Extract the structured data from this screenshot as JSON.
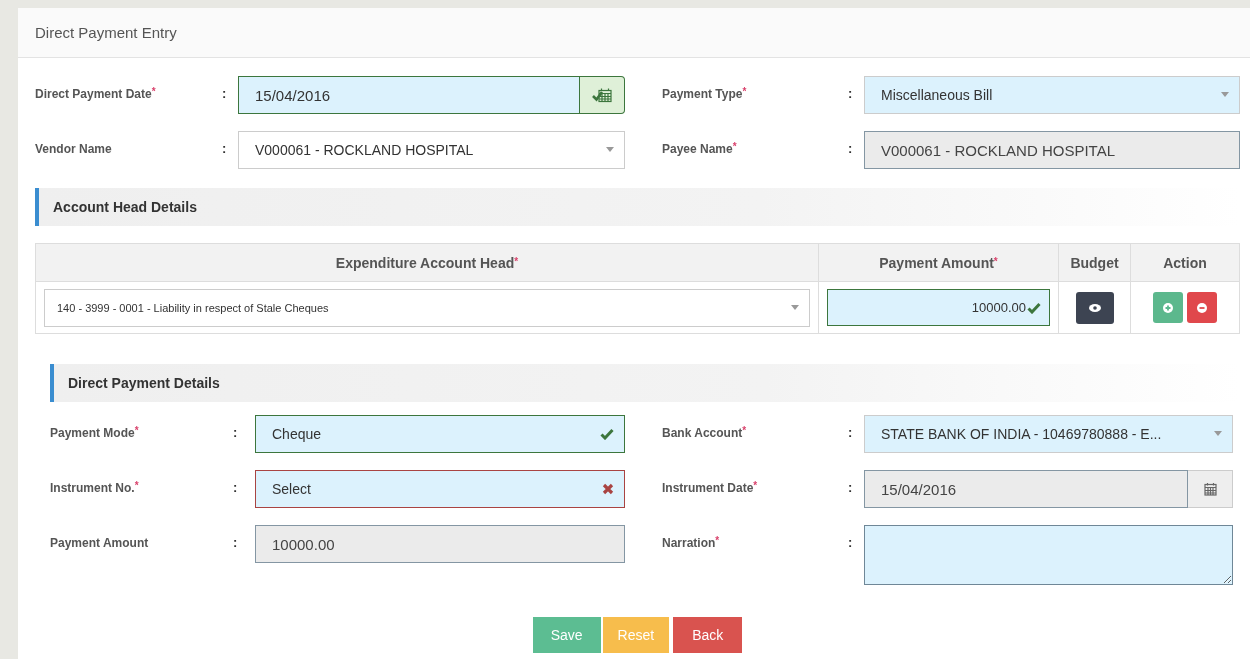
{
  "page_title": "Direct Payment Entry",
  "header_fields": [
    {
      "label": "Direct Payment Date$^{*}$",
      "colon": ":",
      "kind": "date",
      "value": "15/04/2016",
      "highlighted": true,
      "valid": true,
      "invalid": false,
      "readonly": false
    },
    {
      "label": "Payment Type$^{*}$",
      "colon": ":",
      "kind": "select",
      "value": "Miscellaneous Bill",
      "highlighted": true,
      "valid": false,
      "invalid": false,
      "readonly": false
    },
    {
      "label": "Vendor Name",
      "colon": ":",
      "kind": "select",
      "value": "V000061 - ROCKLAND HOSPITAL",
      "highlighted": false,
      "valid": false,
      "invalid": false,
      "readonly": false
    },
    {
      "label": "Payee Name$^{*}$",
      "colon": ":",
      "kind": "text",
      "value": "V000061 - ROCKLAND HOSPITAL",
      "highlighted": false,
      "valid": false,
      "invalid": false,
      "readonly": true
    }
  ],
  "account_section": {
    "title": "Account Head Details",
    "columns": [
      "Expenditure Account Head$^{*}$",
      "Payment Amount$^{*}$",
      "Budget",
      "Action"
    ],
    "rows": [
      {
        "account": "140 - 3999 - 0001 - Liability in respect of Stale Cheques",
        "amount": "10000.00",
        "amount_valid": true
      }
    ]
  },
  "payment_section": {
    "title": "Direct Payment Details",
    "fields": [
      {
        "label": "Payment Mode$^{*}$",
        "colon": ":",
        "kind": "select",
        "value": "Cheque",
        "highlighted": true,
        "valid": true,
        "invalid": false,
        "readonly": false
      },
      {
        "label": "Bank Account$^{*}$",
        "colon": ":",
        "kind": "select",
        "value": "STATE BANK OF INDIA - 10469780888 - E...",
        "highlighted": true,
        "valid": false,
        "invalid": false,
        "readonly": false
      },
      {
        "label": "Instrument No.$^{*}$",
        "colon": ":",
        "kind": "select",
        "value": "Select",
        "highlighted": true,
        "valid": false,
        "invalid": true,
        "readonly": false
      },
      {
        "label": "Instrument Date$^{*}$",
        "colon": ":",
        "kind": "date",
        "value": "15/04/2016",
        "highlighted": false,
        "valid": false,
        "invalid": false,
        "readonly": true
      },
      {
        "label": "Payment Amount",
        "colon": ":",
        "kind": "text",
        "value": "10000.00",
        "highlighted": false,
        "valid": false,
        "invalid": false,
        "readonly": true
      },
      {
        "label": "Narration$^{*}$",
        "colon": ":",
        "kind": "textarea",
        "highlighted": true,
        "valid": false,
        "invalid": false,
        "readonly": false
      }
    ]
  },
  "buttons": [
    {
      "label": "Save",
      "kind": "save"
    },
    {
      "label": "Reset",
      "kind": "reset"
    },
    {
      "label": "Back",
      "kind": "back"
    }
  ]
}
